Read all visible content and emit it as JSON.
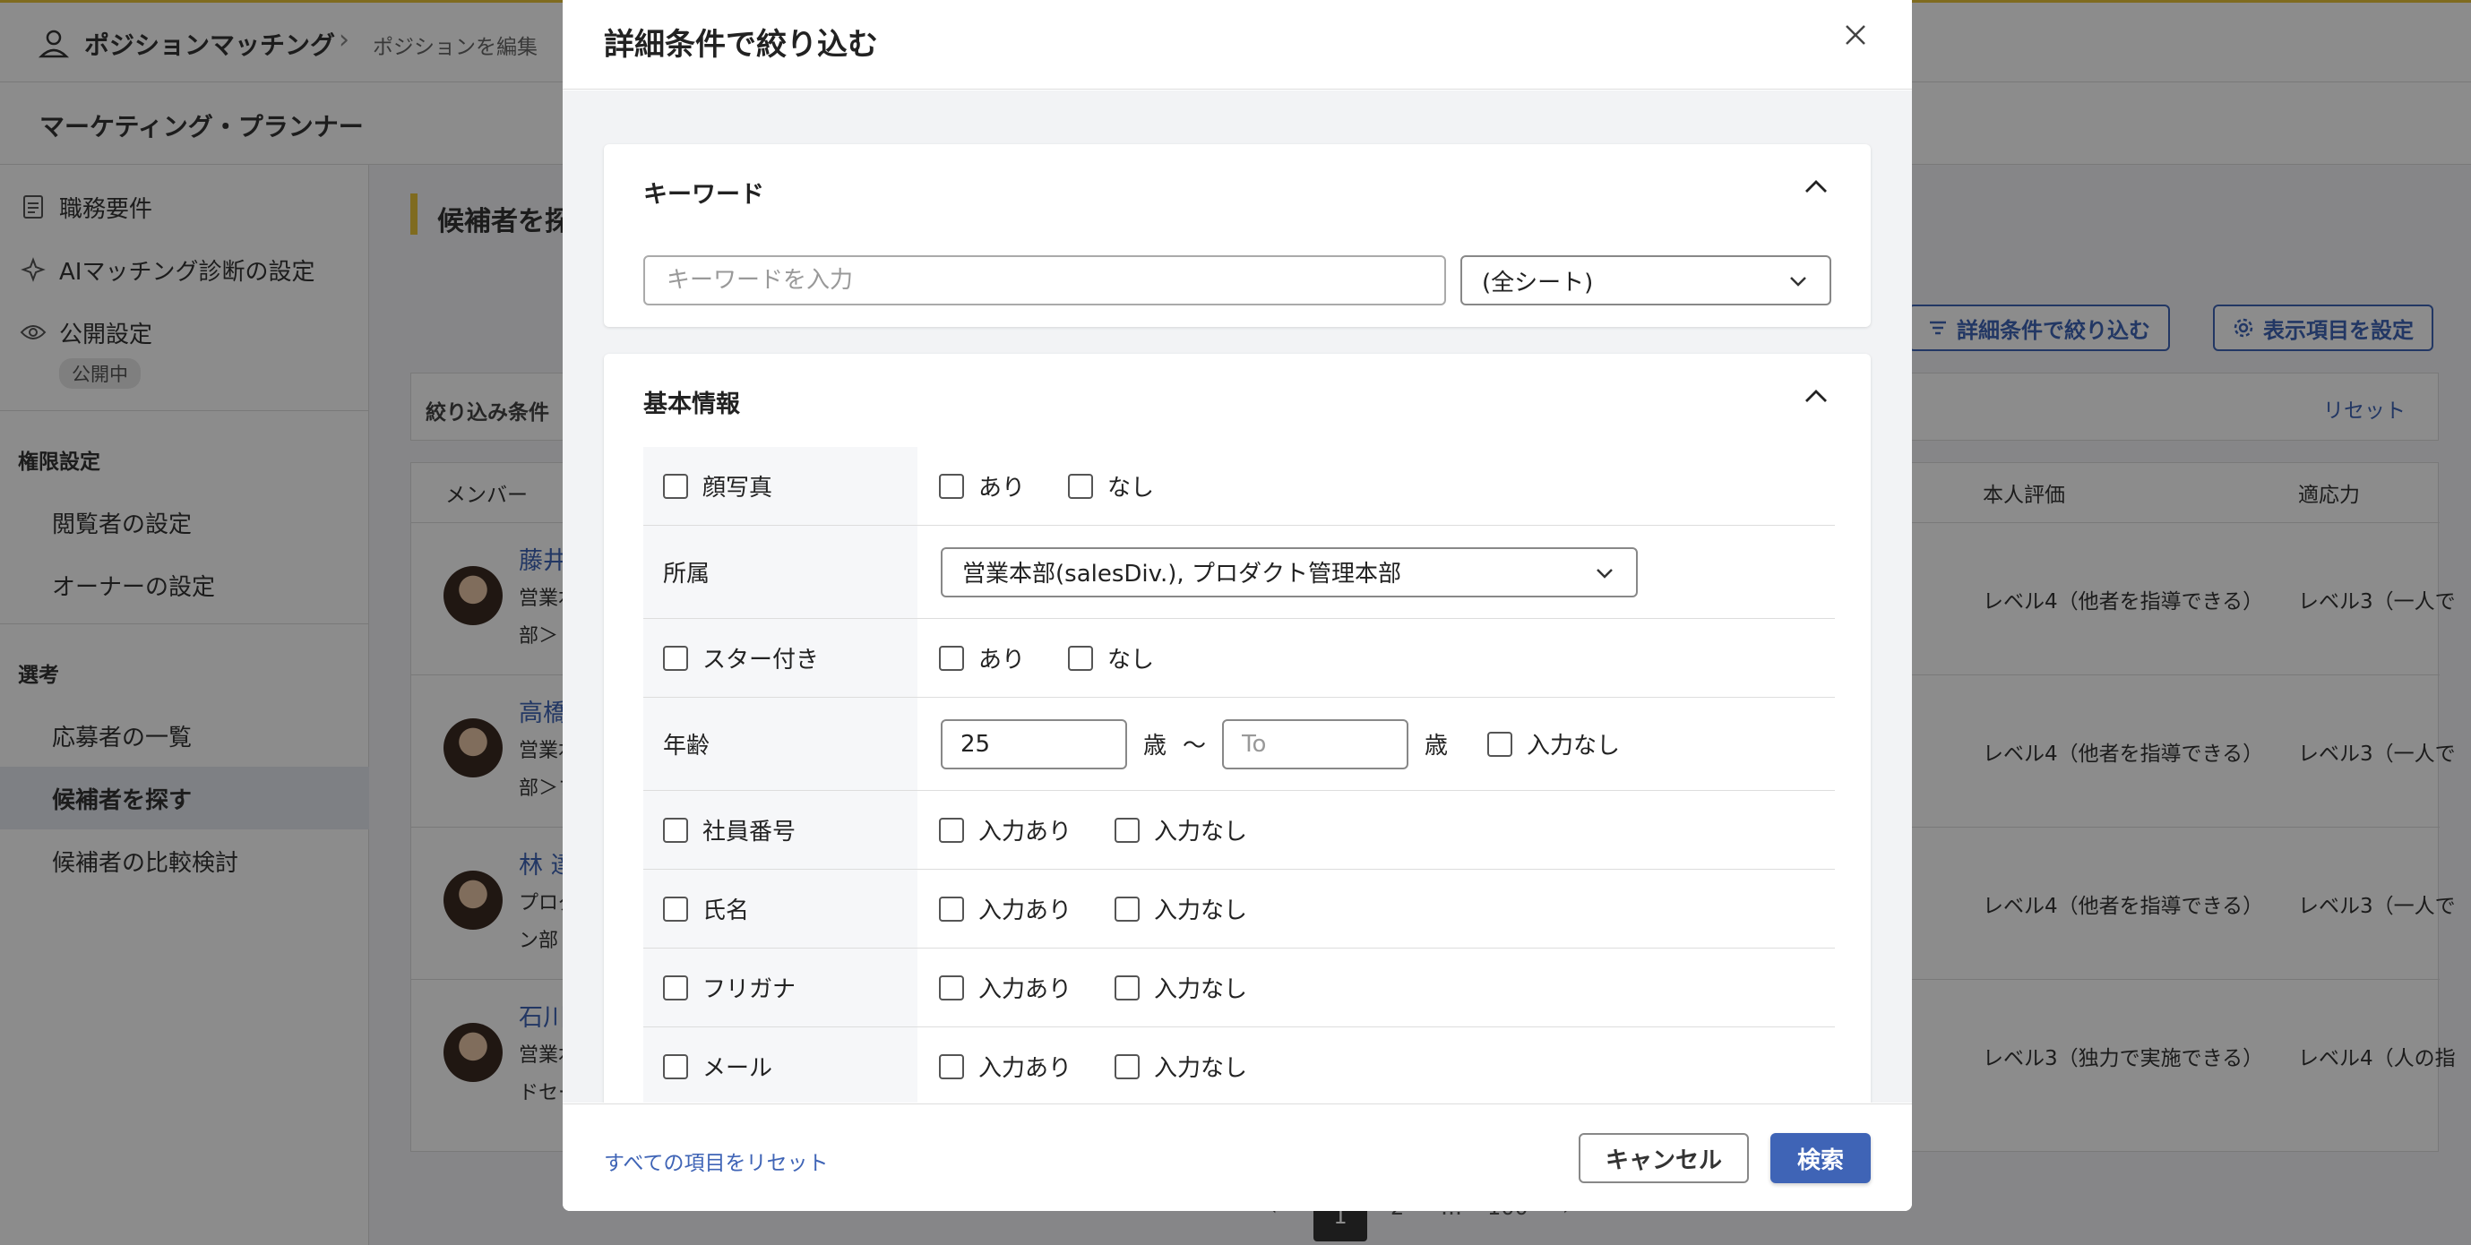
{
  "app": {
    "brand": "ポジションマッチング",
    "breadcrumb_current": "ポジションを編集",
    "position_title": "マーケティング・プランナー"
  },
  "sidebar": {
    "items": [
      {
        "label": "職務要件",
        "icon": "document-icon"
      },
      {
        "label": "AIマッチング診断の設定",
        "icon": "sparkle-icon"
      },
      {
        "label": "公開設定",
        "icon": "eye-icon"
      }
    ],
    "publish_badge": "公開中",
    "section_permissions": "権限設定",
    "permission_items": [
      "閲覧者の設定",
      "オーナーの設定"
    ],
    "section_selection": "選考",
    "selection_items": [
      "応募者の一覧",
      "候補者を探す",
      "候補者の比較検討"
    ]
  },
  "main": {
    "title": "候補者を探",
    "filter_button": "詳細条件で絞り込む",
    "display_button": "表示項目を設定",
    "filter_bar_label": "絞り込み条件",
    "filter_reset": "リセット",
    "columns": {
      "member": "メンバー",
      "self_eval": "本人評価",
      "adaptability": "適応力"
    },
    "rows": [
      {
        "name": "藤井",
        "line1": "営業本",
        "line2": "部＞",
        "self_eval": "レベル4（他者を指導できる）",
        "adapt": "レベル3（一人で"
      },
      {
        "name": "高橋",
        "line1": "営業本",
        "line2": "部＞プ",
        "self_eval": "レベル4（他者を指導できる）",
        "adapt": "レベル3（一人で"
      },
      {
        "name": "林 達",
        "line1": "プロダ",
        "line2": "ン部",
        "self_eval": "レベル4（他者を指導できる）",
        "adapt": "レベル3（一人で"
      },
      {
        "name": "石川",
        "line1": "営業本",
        "line2": "ドセー",
        "self_eval": "レベル3（独力で実施できる）",
        "adapt": "レベル4（人の指"
      }
    ],
    "pager": {
      "current": "1",
      "next": "2",
      "ellipsis": "…",
      "last": "100",
      "prev_glyph": "‹",
      "next_glyph": "›"
    }
  },
  "modal": {
    "title": "詳細条件で絞り込む",
    "keyword_section": {
      "title": "キーワード",
      "input_placeholder": "キーワードを入力",
      "sheet_select_value": "(全シート)"
    },
    "basic_section": {
      "title": "基本情報",
      "rows": {
        "photo": {
          "label": "顔写真",
          "opt1": "あり",
          "opt2": "なし"
        },
        "department": {
          "label": "所属",
          "value": "営業本部(salesDiv.), プロダクト管理本部"
        },
        "starred": {
          "label": "スター付き",
          "opt1": "あり",
          "opt2": "なし"
        },
        "age": {
          "label": "年齢",
          "from_value": "25",
          "unit": "歳",
          "tilde": "〜",
          "to_placeholder": "To",
          "no_input": "入力なし"
        },
        "employee_id": {
          "label": "社員番号",
          "opt1": "入力あり",
          "opt2": "入力なし"
        },
        "name": {
          "label": "氏名",
          "opt1": "入力あり",
          "opt2": "入力なし"
        },
        "furigana": {
          "label": "フリガナ",
          "opt1": "入力あり",
          "opt2": "入力なし"
        },
        "email": {
          "label": "メール",
          "opt1": "入力あり",
          "opt2": "入力なし"
        }
      }
    },
    "footer": {
      "reset_all": "すべての項目をリセット",
      "cancel": "キャンセル",
      "search": "検索"
    }
  },
  "colors": {
    "accent": "#3f64b6",
    "brand_yellow": "#e8c43a"
  }
}
